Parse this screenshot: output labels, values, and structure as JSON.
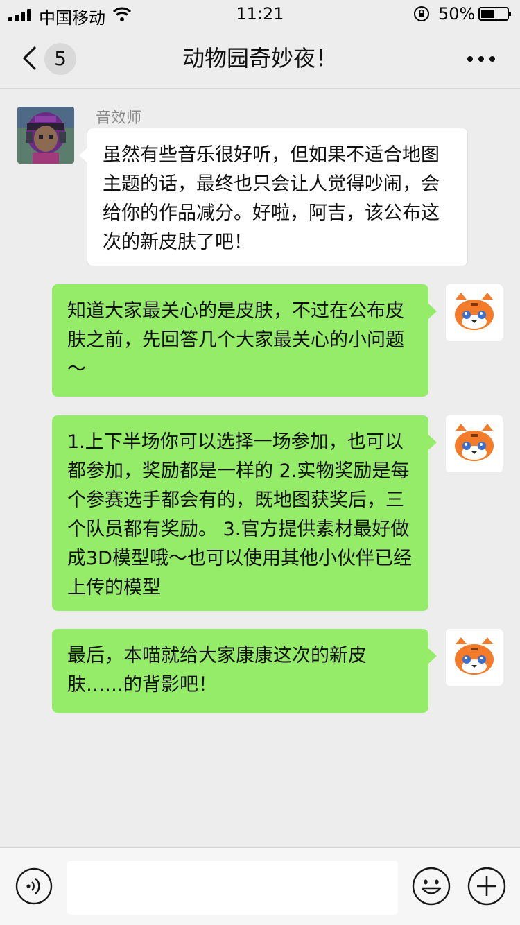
{
  "status_bar": {
    "carrier": "中国移动",
    "time": "11:21",
    "battery": "50%"
  },
  "nav": {
    "unread_count": "5",
    "title": "动物园奇妙夜！"
  },
  "messages": [
    {
      "side": "left",
      "sender": "音效师",
      "text": "虽然有些音乐很好听，但如果不适合地图主题的话，最终也只会让人觉得吵闹，会给你的作品减分。好啦，阿吉，该公布这次的新皮肤了吧！"
    },
    {
      "side": "right",
      "text": "知道大家最关心的是皮肤，不过在公布皮肤之前，先回答几个大家最关心的小问题～"
    },
    {
      "side": "right",
      "text": "1.上下半场你可以选择一场参加，也可以都参加，奖励都是一样的 2.实物奖励是每个参赛选手都会有的，既地图获奖后，三个队员都有奖励。 3.官方提供素材最好做成3D模型哦～也可以使用其他小伙伴已经上传的模型"
    },
    {
      "side": "right",
      "text": "最后，本喵就给大家康康这次的新皮肤……的背影吧！"
    }
  ],
  "input": {
    "value": ""
  },
  "colors": {
    "background": "#ededed",
    "bubble_self": "#95ec69",
    "bubble_other": "#ffffff",
    "avatar_cat": "#f47b2a"
  },
  "icons": [
    "signal-icon",
    "wifi-icon",
    "rotation-lock-icon",
    "battery-icon",
    "back-chevron-icon",
    "more-icon",
    "voice-icon",
    "emoji-icon",
    "plus-icon"
  ]
}
